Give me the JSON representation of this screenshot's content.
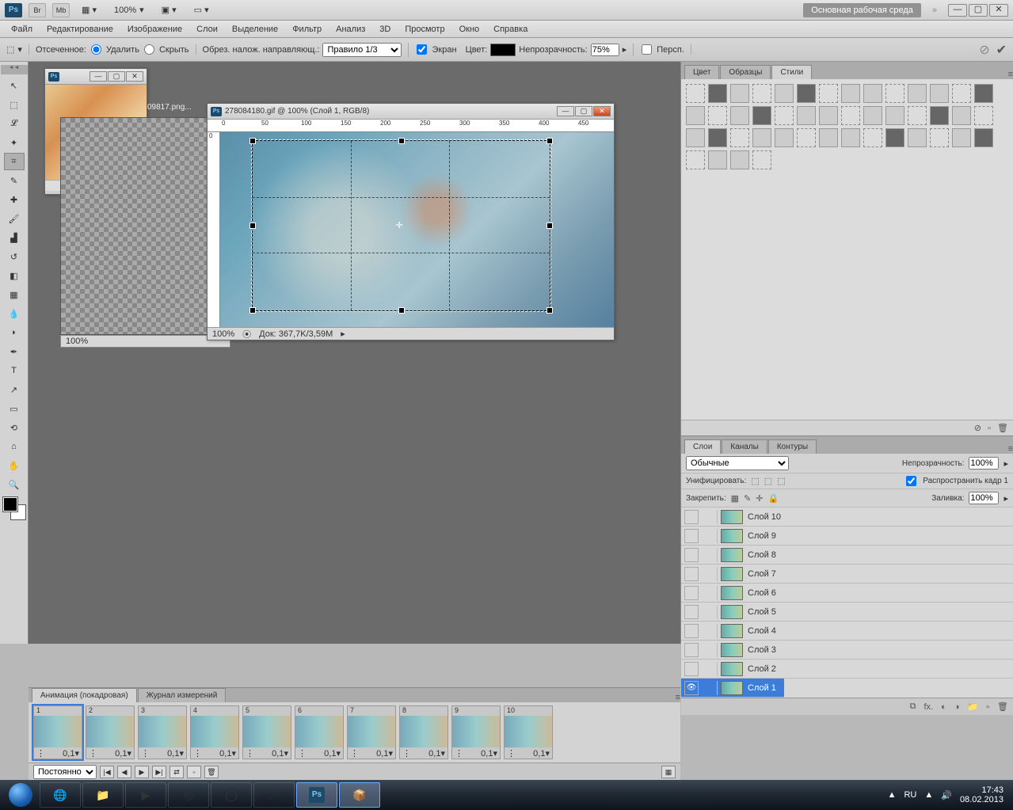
{
  "topbar": {
    "zoom": "100%",
    "workspace_label": "Основная рабочая среда"
  },
  "menu": [
    "Файл",
    "Редактирование",
    "Изображение",
    "Слои",
    "Выделение",
    "Фильтр",
    "Анализ",
    "3D",
    "Просмотр",
    "Окно",
    "Справка"
  ],
  "options": {
    "cut_label": "Отсеченное:",
    "delete": "Удалить",
    "hide": "Скрыть",
    "guides_label": "Обрез. налож. направляющ.:",
    "rule": "Правило 1/3",
    "screen": "Экран",
    "color_label": "Цвет:",
    "opacity_label": "Непрозрачность:",
    "opacity": "75%",
    "persp": "Персп."
  },
  "doc2_tab": "09817.png...",
  "doc_main": {
    "title": "278084180.gif @ 100% (Слой 1, RGB/8)",
    "status_zoom": "100%",
    "status_doc": "Док: 367,7K/3,59M"
  },
  "doc_thumb": {
    "status_zoom": "100%"
  },
  "panel_color": {
    "tabs": [
      "Цвет",
      "Образцы",
      "Стили"
    ],
    "active": 2
  },
  "panel_layers": {
    "tabs": [
      "Слои",
      "Каналы",
      "Контуры"
    ],
    "active": 0,
    "blend": "Обычные",
    "opacity_label": "Непрозрачность:",
    "opacity": "100%",
    "unify": "Унифицировать:",
    "propagate": "Распространить кадр 1",
    "lock": "Закрепить:",
    "fill_label": "Заливка:",
    "fill": "100%",
    "layers": [
      "Слой 10",
      "Слой 9",
      "Слой 8",
      "Слой 7",
      "Слой 6",
      "Слой 5",
      "Слой 4",
      "Слой 3",
      "Слой 2",
      "Слой 1"
    ]
  },
  "anim": {
    "tabs": [
      "Анимация (покадровая)",
      "Журнал измерений"
    ],
    "frame_time": "0,1",
    "loop": "Постоянно"
  },
  "taskbar": {
    "lang": "RU",
    "time": "17:43",
    "date": "08.02.2013"
  }
}
